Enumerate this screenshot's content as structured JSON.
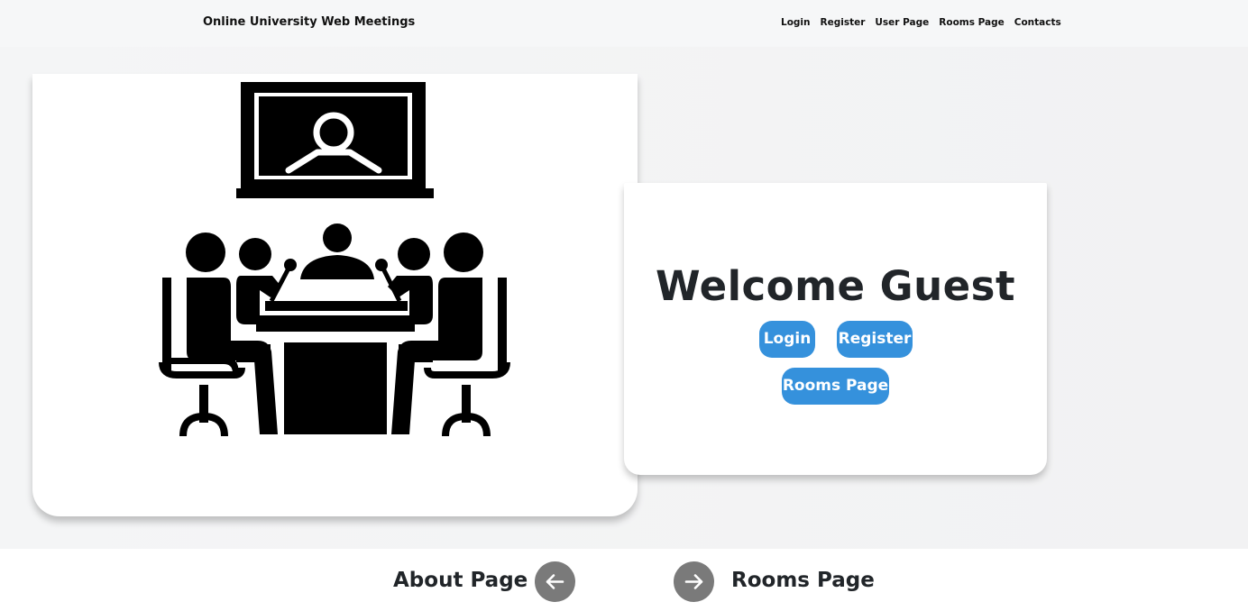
{
  "navbar": {
    "brand": "Online University Web Meetings",
    "links": [
      "Login",
      "Register",
      "User Page",
      "Rooms Page",
      "Contacts"
    ]
  },
  "hero": {
    "illustration_icon": "video-conference-meeting-icon"
  },
  "welcome": {
    "title": "Welcome Guest",
    "login_label": "Login",
    "register_label": "Register",
    "rooms_label": "Rooms Page"
  },
  "footer_nav": {
    "prev_label": "About Page",
    "prev_icon": "arrow-left-icon",
    "next_label": "Rooms Page",
    "next_icon": "arrow-right-icon"
  },
  "colors": {
    "button": "#3591dc",
    "circle_button": "#7a7a7a",
    "text": "#212529"
  }
}
